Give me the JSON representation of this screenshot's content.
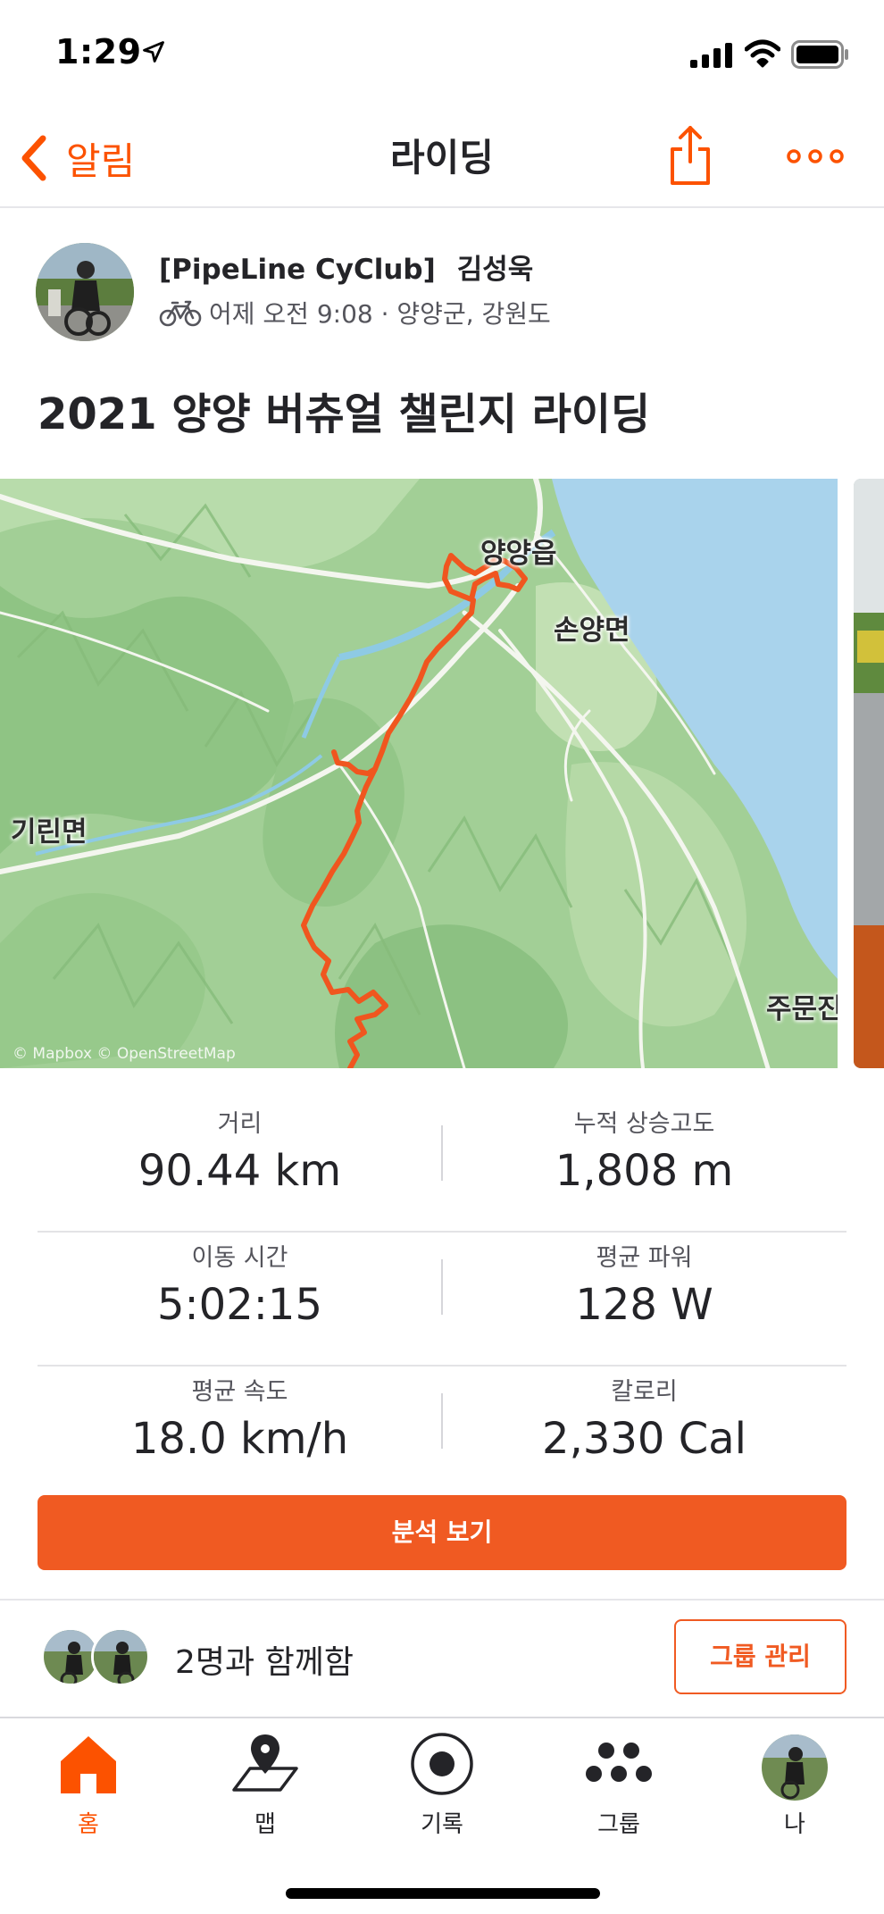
{
  "status_bar": {
    "time": "1:29"
  },
  "nav": {
    "back_label": "알림",
    "title": "라이딩"
  },
  "activity": {
    "club": "[PipeLine CyClub]",
    "athlete": "김성욱",
    "meta": "어제 오전 9:08 · 양양군, 강원도",
    "title": "2021 양양 버츄얼 챌린지 라이딩"
  },
  "map": {
    "labels": {
      "town": "양양읍",
      "son_yang": "손양면",
      "girin": "기린면",
      "jumun": "주문진"
    },
    "attribution": "© Mapbox © OpenStreetMap"
  },
  "stats": [
    {
      "label": "거리",
      "value": "90.44 km"
    },
    {
      "label": "누적 상승고도",
      "value": "1,808 m"
    },
    {
      "label": "이동 시간",
      "value": "5:02:15"
    },
    {
      "label": "평균 파워",
      "value": "128 W"
    },
    {
      "label": "평균 속도",
      "value": "18.0 km/h"
    },
    {
      "label": "칼로리",
      "value": "2,330 Cal"
    }
  ],
  "analysis_button": "분석 보기",
  "group": {
    "text": "2명과 함께함",
    "manage_button": "그룹 관리"
  },
  "tabs": [
    {
      "label": "홈",
      "icon": "home-icon",
      "active": true
    },
    {
      "label": "맵",
      "icon": "map-icon",
      "active": false
    },
    {
      "label": "기록",
      "icon": "record-icon",
      "active": false
    },
    {
      "label": "그룹",
      "icon": "groups-icon",
      "active": false
    },
    {
      "label": "나",
      "icon": "profile-avatar",
      "active": false
    }
  ],
  "colors": {
    "brand": "#fc5200",
    "button": "#f05a22",
    "route": "#f0561f",
    "water": "#a9d3ec"
  }
}
